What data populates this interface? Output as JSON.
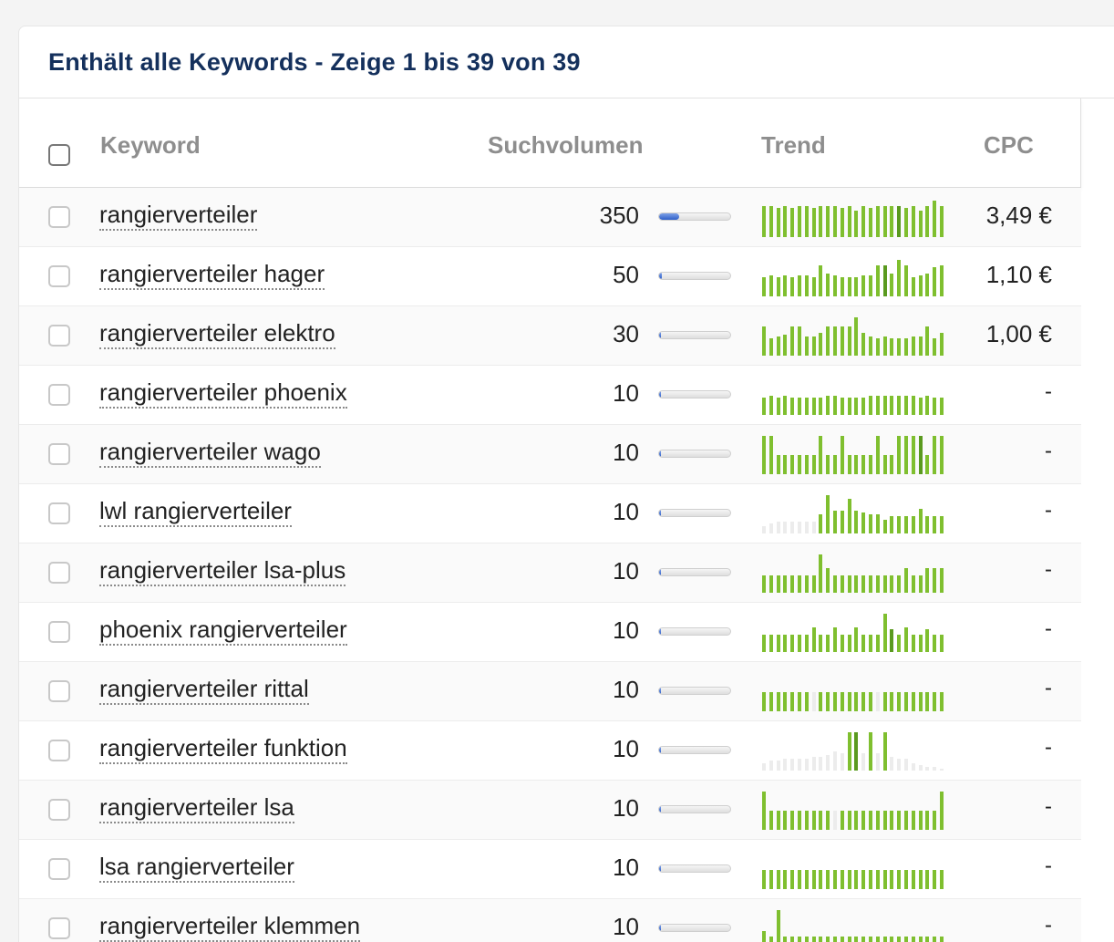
{
  "title": "Enthält alle Keywords - Zeige 1 bis 39 von 39",
  "columns": {
    "keyword": "Keyword",
    "volume": "Suchvolumen",
    "trend": "Trend",
    "cpc": "CPC"
  },
  "colors": {
    "trend_light": "#7fbf2f",
    "trend_dark": "#5a9a1f",
    "trend_empty": "#ececec",
    "volume_fill": "#3567cf",
    "title": "#14305c"
  },
  "volume_max": 350,
  "rows": [
    {
      "keyword": "rangierverteiler",
      "volume": "350",
      "cpc": "3,49 €",
      "trend": [
        0.8,
        0.8,
        0.75,
        0.8,
        0.75,
        0.8,
        0.8,
        0.75,
        0.8,
        0.8,
        0.8,
        0.75,
        0.8,
        0.7,
        0.8,
        0.75,
        0.8,
        0.8,
        0.8,
        0.8,
        0.75,
        0.8,
        0.7,
        0.8,
        0.95,
        0.8
      ],
      "trend_tone": [
        0,
        0,
        0,
        0,
        0,
        0,
        0,
        0,
        0,
        0,
        0,
        0,
        0,
        0,
        0,
        0,
        0,
        0,
        0,
        1,
        0,
        0,
        0,
        0,
        0,
        0
      ]
    },
    {
      "keyword": "rangierverteiler hager",
      "volume": "50",
      "cpc": "1,10 €",
      "trend": [
        0.5,
        0.55,
        0.5,
        0.55,
        0.5,
        0.55,
        0.55,
        0.5,
        0.8,
        0.6,
        0.55,
        0.5,
        0.5,
        0.5,
        0.55,
        0.55,
        0.8,
        0.8,
        0.6,
        0.95,
        0.8,
        0.5,
        0.55,
        0.6,
        0.75,
        0.8
      ],
      "trend_tone": [
        0,
        0,
        0,
        0,
        0,
        0,
        0,
        0,
        0,
        0,
        0,
        0,
        0,
        0,
        0,
        0,
        0,
        1,
        0,
        0,
        0,
        0,
        0,
        0,
        0,
        0
      ]
    },
    {
      "keyword": "rangierverteiler elektro",
      "volume": "30",
      "cpc": "1,00 €",
      "trend": [
        0.75,
        0.45,
        0.5,
        0.55,
        0.75,
        0.75,
        0.5,
        0.5,
        0.6,
        0.75,
        0.75,
        0.75,
        0.75,
        1.0,
        0.6,
        0.5,
        0.45,
        0.5,
        0.45,
        0.45,
        0.45,
        0.5,
        0.5,
        0.75,
        0.45,
        0.6
      ],
      "trend_tone": [
        0,
        0,
        0,
        0,
        0,
        0,
        0,
        0,
        0,
        0,
        0,
        0,
        0,
        0,
        0,
        0,
        0,
        0,
        0,
        0,
        0,
        0,
        0,
        0,
        0,
        0
      ]
    },
    {
      "keyword": "rangierverteiler phoenix",
      "volume": "10",
      "cpc": "-",
      "trend": [
        0.45,
        0.5,
        0.45,
        0.5,
        0.45,
        0.45,
        0.45,
        0.45,
        0.45,
        0.5,
        0.5,
        0.45,
        0.45,
        0.45,
        0.45,
        0.5,
        0.5,
        0.5,
        0.5,
        0.5,
        0.5,
        0.5,
        0.45,
        0.5,
        0.45,
        0.45
      ],
      "trend_tone": [
        0,
        0,
        0,
        0,
        0,
        0,
        0,
        0,
        0,
        0,
        0,
        0,
        0,
        0,
        0,
        0,
        0,
        0,
        0,
        0,
        0,
        0,
        0,
        0,
        0,
        0
      ]
    },
    {
      "keyword": "rangierverteiler wago",
      "volume": "10",
      "cpc": "-",
      "trend": [
        1.0,
        1.0,
        0.5,
        0.5,
        0.5,
        0.5,
        0.5,
        0.5,
        1.0,
        0.5,
        0.5,
        1.0,
        0.5,
        0.5,
        0.5,
        0.5,
        1.0,
        0.5,
        0.5,
        1.0,
        1.0,
        1.0,
        1.0,
        0.5,
        1.0,
        1.0
      ],
      "trend_tone": [
        0,
        0,
        0,
        0,
        0,
        0,
        0,
        0,
        0,
        0,
        0,
        0,
        0,
        0,
        0,
        0,
        0,
        0,
        0,
        0,
        0,
        0,
        1,
        0,
        0,
        0
      ]
    },
    {
      "keyword": "lwl rangierverteiler",
      "volume": "10",
      "cpc": "-",
      "trend": [
        0.2,
        0.25,
        0.3,
        0.3,
        0.3,
        0.3,
        0.3,
        0.3,
        0.5,
        1.0,
        0.6,
        0.6,
        0.9,
        0.6,
        0.55,
        0.5,
        0.5,
        0.35,
        0.45,
        0.45,
        0.45,
        0.45,
        0.65,
        0.45,
        0.45,
        0.45
      ],
      "trend_tone": [
        2,
        2,
        2,
        2,
        2,
        2,
        2,
        2,
        0,
        0,
        0,
        0,
        0,
        0,
        0,
        0,
        0,
        0,
        0,
        0,
        0,
        0,
        0,
        0,
        0,
        0
      ]
    },
    {
      "keyword": "rangierverteiler lsa-plus",
      "volume": "10",
      "cpc": "-",
      "trend": [
        0.45,
        0.45,
        0.45,
        0.45,
        0.45,
        0.45,
        0.45,
        0.45,
        1.0,
        0.65,
        0.45,
        0.45,
        0.45,
        0.45,
        0.45,
        0.45,
        0.45,
        0.45,
        0.45,
        0.45,
        0.65,
        0.45,
        0.45,
        0.65,
        0.65,
        0.65
      ],
      "trend_tone": [
        0,
        0,
        0,
        0,
        0,
        0,
        0,
        0,
        0,
        0,
        0,
        0,
        0,
        0,
        0,
        0,
        0,
        0,
        0,
        0,
        0,
        0,
        0,
        0,
        0,
        0
      ]
    },
    {
      "keyword": "phoenix rangierverteiler",
      "volume": "10",
      "cpc": "-",
      "trend": [
        0.45,
        0.45,
        0.45,
        0.45,
        0.45,
        0.45,
        0.45,
        0.65,
        0.45,
        0.45,
        0.65,
        0.45,
        0.45,
        0.65,
        0.45,
        0.45,
        0.45,
        1.0,
        0.6,
        0.45,
        0.65,
        0.45,
        0.45,
        0.6,
        0.45,
        0.45
      ],
      "trend_tone": [
        0,
        0,
        0,
        0,
        0,
        0,
        0,
        0,
        0,
        0,
        0,
        0,
        0,
        0,
        0,
        0,
        0,
        0,
        1,
        0,
        0,
        0,
        0,
        0,
        0,
        0
      ]
    },
    {
      "keyword": "rangierverteiler rittal",
      "volume": "10",
      "cpc": "-",
      "trend": [
        0.5,
        0.5,
        0.5,
        0.5,
        0.5,
        0.5,
        0.5,
        0.5,
        0.5,
        0.5,
        0.5,
        0.5,
        0.5,
        0.5,
        0.5,
        0.5,
        0.5,
        0.5,
        0.5,
        0.5,
        0.5,
        0.5,
        0.5,
        0.5,
        0.5,
        0.5
      ],
      "trend_tone": [
        0,
        0,
        0,
        0,
        0,
        0,
        0,
        2,
        0,
        0,
        0,
        0,
        0,
        0,
        0,
        0,
        2,
        0,
        0,
        0,
        0,
        0,
        0,
        0,
        0,
        0
      ]
    },
    {
      "keyword": "rangierverteiler funktion",
      "volume": "10",
      "cpc": "-",
      "trend": [
        0.2,
        0.25,
        0.25,
        0.3,
        0.3,
        0.3,
        0.3,
        0.35,
        0.35,
        0.4,
        0.5,
        0.45,
        1.0,
        1.0,
        0.45,
        1.0,
        0.45,
        1.0,
        0.35,
        0.3,
        0.3,
        0.2,
        0.15,
        0.1,
        0.1,
        0.05
      ],
      "trend_tone": [
        2,
        2,
        2,
        2,
        2,
        2,
        2,
        2,
        2,
        2,
        2,
        2,
        0,
        1,
        2,
        0,
        2,
        0,
        2,
        2,
        2,
        2,
        2,
        2,
        2,
        2
      ]
    },
    {
      "keyword": "rangierverteiler lsa",
      "volume": "10",
      "cpc": "-",
      "trend": [
        1.0,
        0.5,
        0.5,
        0.5,
        0.5,
        0.5,
        0.5,
        0.5,
        0.5,
        0.5,
        0.5,
        0.5,
        0.5,
        0.5,
        0.5,
        0.5,
        0.5,
        0.5,
        0.5,
        0.5,
        0.5,
        0.5,
        0.5,
        0.5,
        0.5,
        1.0
      ],
      "trend_tone": [
        0,
        0,
        0,
        0,
        0,
        0,
        0,
        0,
        0,
        0,
        2,
        0,
        0,
        0,
        0,
        0,
        0,
        0,
        0,
        0,
        0,
        0,
        0,
        0,
        0,
        0
      ]
    },
    {
      "keyword": "lsa rangierverteiler",
      "volume": "10",
      "cpc": "-",
      "trend": [
        0.5,
        0.5,
        0.5,
        0.5,
        0.5,
        0.5,
        0.5,
        0.5,
        0.5,
        0.5,
        0.5,
        0.5,
        0.5,
        0.5,
        0.5,
        0.5,
        0.5,
        0.5,
        0.5,
        0.5,
        0.5,
        0.5,
        0.5,
        0.5,
        0.5,
        0.5
      ],
      "trend_tone": [
        0,
        0,
        0,
        0,
        0,
        0,
        0,
        0,
        0,
        0,
        0,
        0,
        0,
        0,
        0,
        0,
        0,
        0,
        0,
        0,
        0,
        0,
        0,
        0,
        0,
        0
      ]
    },
    {
      "keyword": "rangierverteiler klemmen",
      "volume": "10",
      "cpc": "-",
      "trend": [
        0.45,
        0.3,
        1.0,
        0.3,
        0.3,
        0.3,
        0.3,
        0.3,
        0.3,
        0.3,
        0.3,
        0.3,
        0.3,
        0.3,
        0.3,
        0.3,
        0.3,
        0.3,
        0.3,
        0.3,
        0.3,
        0.3,
        0.3,
        0.3,
        0.3,
        0.3
      ],
      "trend_tone": [
        0,
        0,
        0,
        0,
        0,
        0,
        0,
        0,
        0,
        0,
        0,
        0,
        0,
        0,
        0,
        0,
        0,
        0,
        0,
        0,
        0,
        0,
        0,
        0,
        0,
        0
      ]
    }
  ]
}
